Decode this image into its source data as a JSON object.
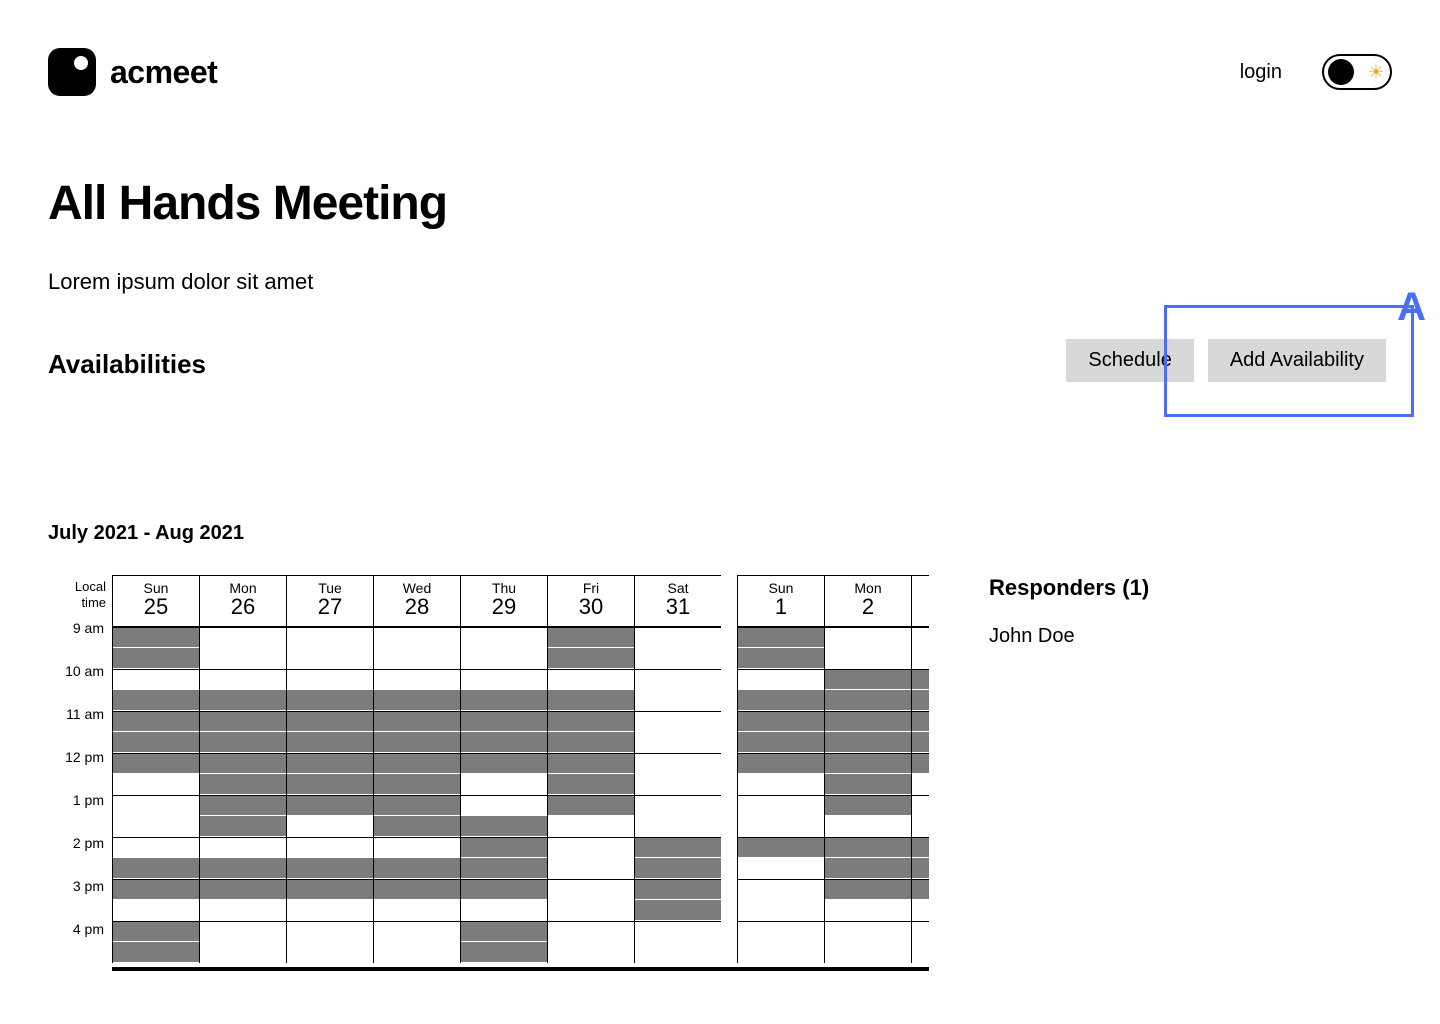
{
  "brand": {
    "name": "acmeet"
  },
  "nav": {
    "login": "login"
  },
  "meeting": {
    "title": "All Hands Meeting",
    "description": "Lorem ipsum dolor sit amet"
  },
  "section": {
    "title": "Availabilities"
  },
  "actions": {
    "schedule": "Schedule",
    "add": "Add Availability"
  },
  "annotation": "A",
  "range": "July 2021 - Aug  2021",
  "tz_label1": "Local",
  "tz_label2": "time",
  "hours": [
    "9 am",
    "10 am",
    "11 am",
    "12 pm",
    "1 pm",
    "2 pm",
    "3 pm",
    "4 pm"
  ],
  "days": [
    {
      "dow": "Sun",
      "num": "25",
      "gap": false,
      "slots": [
        1,
        1,
        0,
        1,
        1,
        1,
        1,
        0,
        0,
        0,
        0,
        1,
        1,
        0,
        1,
        1
      ]
    },
    {
      "dow": "Mon",
      "num": "26",
      "gap": false,
      "slots": [
        0,
        0,
        0,
        1,
        1,
        1,
        1,
        1,
        1,
        1,
        0,
        1,
        1,
        0,
        0,
        0
      ]
    },
    {
      "dow": "Tue",
      "num": "27",
      "gap": false,
      "slots": [
        0,
        0,
        0,
        1,
        1,
        1,
        1,
        1,
        1,
        0,
        0,
        1,
        1,
        0,
        0,
        0
      ]
    },
    {
      "dow": "Wed",
      "num": "28",
      "gap": false,
      "slots": [
        0,
        0,
        0,
        1,
        1,
        1,
        1,
        1,
        1,
        1,
        0,
        1,
        1,
        0,
        0,
        0
      ]
    },
    {
      "dow": "Thu",
      "num": "29",
      "gap": false,
      "slots": [
        0,
        0,
        0,
        1,
        1,
        1,
        1,
        0,
        0,
        1,
        1,
        1,
        1,
        0,
        1,
        1
      ]
    },
    {
      "dow": "Fri",
      "num": "30",
      "gap": false,
      "slots": [
        1,
        1,
        0,
        1,
        1,
        1,
        1,
        1,
        1,
        0,
        0,
        0,
        0,
        0,
        0,
        0
      ]
    },
    {
      "dow": "Sat",
      "num": "31",
      "gap": false,
      "slots": [
        0,
        0,
        0,
        0,
        0,
        0,
        0,
        0,
        0,
        0,
        1,
        1,
        1,
        1,
        0,
        0
      ]
    },
    {
      "dow": "Sun",
      "num": "1",
      "gap": true,
      "slots": [
        1,
        1,
        0,
        1,
        1,
        1,
        1,
        0,
        0,
        0,
        1,
        0,
        0,
        0,
        0,
        0
      ]
    },
    {
      "dow": "Mon",
      "num": "2",
      "gap": false,
      "slots": [
        0,
        0,
        1,
        1,
        1,
        1,
        1,
        1,
        1,
        0,
        1,
        1,
        1,
        0,
        0,
        0
      ]
    }
  ],
  "edge_slots": [
    0,
    0,
    1,
    1,
    1,
    1,
    1,
    0,
    0,
    0,
    1,
    1,
    1,
    0,
    0,
    0
  ],
  "responders": {
    "title": "Responders  (1)",
    "items": [
      "John Doe"
    ]
  },
  "colors": {
    "annotation": "#4a6ef5",
    "fill": "#7c7c7c"
  }
}
